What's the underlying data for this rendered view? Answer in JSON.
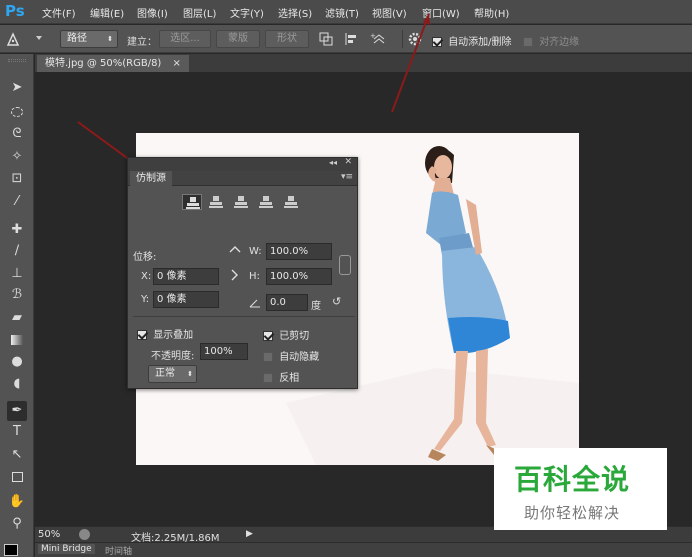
{
  "app": {
    "logo": "Ps"
  },
  "menu": [
    "文件(F)",
    "编辑(E)",
    "图像(I)",
    "图层(L)",
    "文字(Y)",
    "选择(S)",
    "滤镜(T)",
    "视图(V)",
    "窗口(W)",
    "帮助(H)"
  ],
  "options": {
    "mode": "路径",
    "build_label": "建立：",
    "selection_btn": "选区...",
    "mask_btn": "蒙版",
    "shape_btn": "形状",
    "auto_add_delete": "自动添加/删除",
    "align_edges": "对齐边缘"
  },
  "document": {
    "tab_title": "模特.jpg @ 50%(RGB/8)",
    "close_glyph": "×"
  },
  "panel": {
    "tab": "仿制源",
    "offset_label": "位移:",
    "x_label": "X:",
    "x_value": "0 像素",
    "y_label": "Y:",
    "y_value": "0 像素",
    "w_label": "W:",
    "w_value": "100.0%",
    "h_label": "H:",
    "h_value": "100.0%",
    "angle_value": "0.0",
    "angle_unit": "度",
    "show_overlay": "显示叠加",
    "opacity_label": "不透明度:",
    "opacity_value": "100%",
    "blend_mode": "正常",
    "clipped": "已剪切",
    "auto_hide": "自动隐藏",
    "invert": "反相"
  },
  "status": {
    "zoom": "50%",
    "doc_info": "文档:2.25M/1.86M"
  },
  "bottom_tabs": [
    "Mini Bridge",
    "时间轴"
  ],
  "watermark": {
    "title": "百科全说",
    "subtitle": "助你轻松解决"
  },
  "colors": {
    "accent_blue": "#2fa6f0",
    "watermark_green": "#2aa83a",
    "annotation_red": "#8b1a1a"
  }
}
